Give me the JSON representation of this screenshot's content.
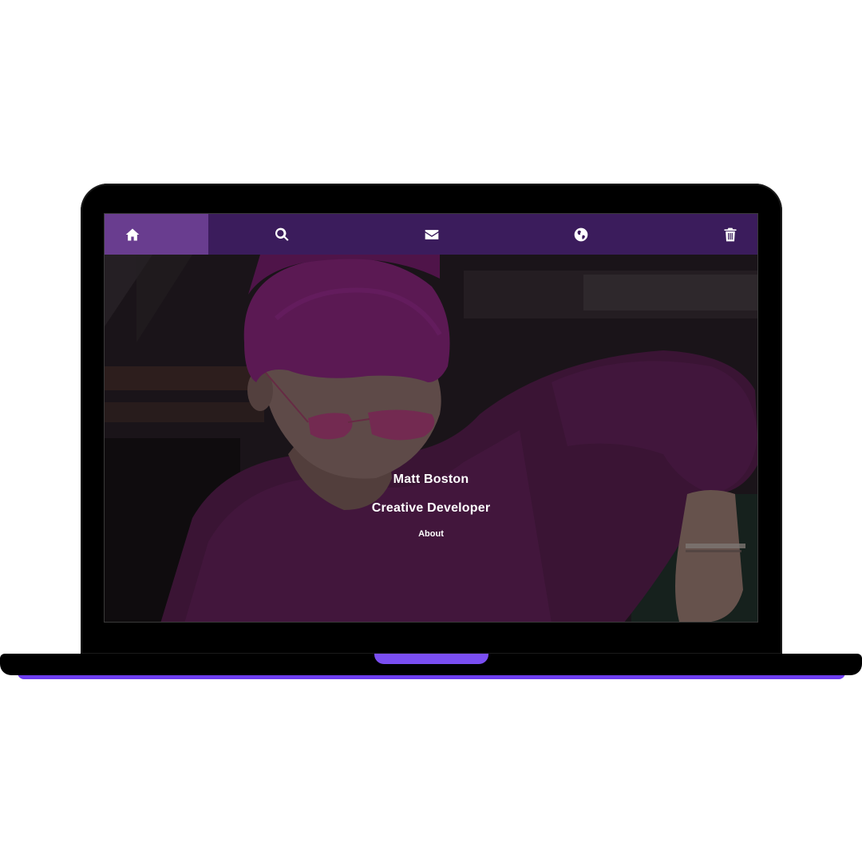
{
  "nav": {
    "items": [
      {
        "name": "home",
        "icon": "home-icon",
        "active": true
      },
      {
        "name": "search",
        "icon": "search-icon",
        "active": false
      },
      {
        "name": "mail",
        "icon": "envelope-icon",
        "active": false
      },
      {
        "name": "globe",
        "icon": "globe-icon",
        "active": false
      },
      {
        "name": "trash",
        "icon": "trash-icon",
        "active": false
      }
    ]
  },
  "hero": {
    "name": "Matt Boston",
    "title": "Creative Developer",
    "link_label": "About"
  },
  "colors": {
    "nav_background": "#3b1c5c",
    "nav_active": "#693d8f",
    "laptop_accent": "#6d3df0",
    "text": "#ffffff"
  }
}
